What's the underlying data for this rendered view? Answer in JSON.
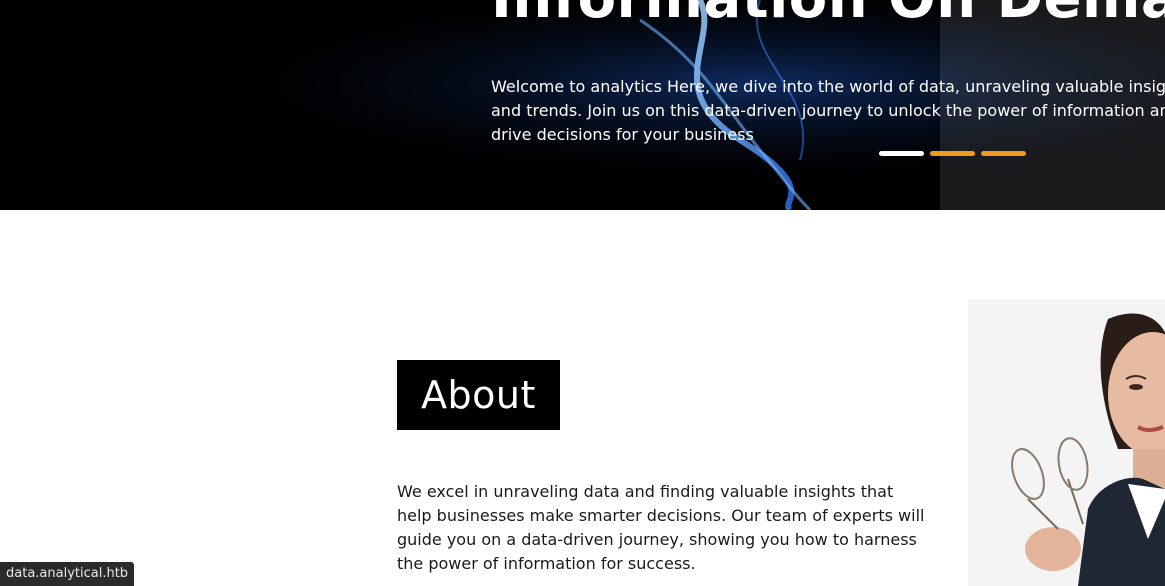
{
  "hero": {
    "title": "Information On Deman",
    "text": "Welcome to analytics Here, we dive into the world of data, unraveling valuable insights and trends. Join us on this data-driven journey to unlock the power of information and drive decisions for your business",
    "carousel": {
      "slides": 3,
      "active_index": 0,
      "active_color": "#ffffff",
      "inactive_color": "#ef9a1a"
    }
  },
  "about": {
    "heading": "About",
    "text": "We excel in unraveling data and finding valuable insights that help businesses make smarter decisions. Our team of experts will guide you on a data-driven journey, showing you how to harness the power of information for success.",
    "image": "businesswoman-holding-glasses-photo"
  },
  "status_bar": {
    "url": "data.analytical.htb"
  }
}
